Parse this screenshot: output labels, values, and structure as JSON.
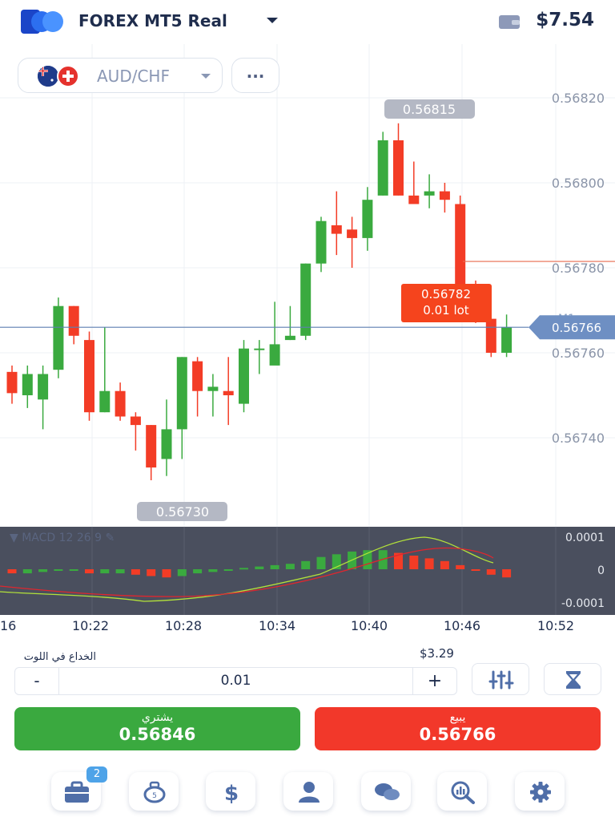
{
  "header": {
    "account_title": "FOREX MT5 Real",
    "balance": "$7.54"
  },
  "instrument": {
    "pair": "AUD/CHF",
    "more_label": "..."
  },
  "chart": {
    "price_labels": [
      "0.56820",
      "0.56800",
      "0.56780",
      "0.56760",
      "0.56740"
    ],
    "time_labels": [
      "16",
      "10:22",
      "10:28",
      "10:34",
      "10:40",
      "10:46",
      "10:52"
    ],
    "high_marker": "0.56815",
    "low_marker": "0.56730",
    "current_price": "0.56766",
    "timeframe": "M1",
    "order_price": "0.56782",
    "order_lot": "0.01 lot",
    "macd_label": "MACD 12 26 9",
    "macd_levels": [
      "0.0001",
      "0",
      "-0.0001"
    ],
    "colors": {
      "bull": "#3aaa3f",
      "bear": "#f33c26",
      "macd_bg": "#4a4f5e",
      "price_line": "#5577aa"
    }
  },
  "chart_data": {
    "type": "candlestick",
    "y_range": [
      0.56725,
      0.56835
    ],
    "candles": [
      {
        "o": 0.567555,
        "c": 0.567505,
        "h": 0.56757,
        "l": 0.56748
      },
      {
        "o": 0.5675,
        "c": 0.56755,
        "h": 0.56757,
        "l": 0.56747
      },
      {
        "o": 0.56749,
        "c": 0.56755,
        "h": 0.56757,
        "l": 0.56742
      },
      {
        "o": 0.56756,
        "c": 0.56771,
        "h": 0.56773,
        "l": 0.56754
      },
      {
        "o": 0.56771,
        "c": 0.56764,
        "h": 0.56771,
        "l": 0.56762
      },
      {
        "o": 0.56763,
        "c": 0.56746,
        "h": 0.56765,
        "l": 0.56744
      },
      {
        "o": 0.56746,
        "c": 0.56751,
        "h": 0.56766,
        "l": 0.56746
      },
      {
        "o": 0.56751,
        "c": 0.56745,
        "h": 0.56753,
        "l": 0.56744
      },
      {
        "o": 0.56745,
        "c": 0.56743,
        "h": 0.56746,
        "l": 0.56737
      },
      {
        "o": 0.56743,
        "c": 0.56733,
        "h": 0.56743,
        "l": 0.5673
      },
      {
        "o": 0.56735,
        "c": 0.56742,
        "h": 0.56749,
        "l": 0.56731
      },
      {
        "o": 0.56742,
        "c": 0.56759,
        "h": 0.56759,
        "l": 0.56735
      },
      {
        "o": 0.56758,
        "c": 0.56751,
        "h": 0.56759,
        "l": 0.56745
      },
      {
        "o": 0.56751,
        "c": 0.56752,
        "h": 0.56755,
        "l": 0.56745
      },
      {
        "o": 0.56751,
        "c": 0.5675,
        "h": 0.56759,
        "l": 0.56743
      },
      {
        "o": 0.56748,
        "c": 0.56761,
        "h": 0.56763,
        "l": 0.56746
      },
      {
        "o": 0.56761,
        "c": 0.56761,
        "h": 0.56763,
        "l": 0.56755
      },
      {
        "o": 0.56757,
        "c": 0.56762,
        "h": 0.56772,
        "l": 0.5676
      },
      {
        "o": 0.56763,
        "c": 0.56764,
        "h": 0.56771,
        "l": 0.56763
      },
      {
        "o": 0.56764,
        "c": 0.56781,
        "h": 0.56781,
        "l": 0.56763
      },
      {
        "o": 0.56781,
        "c": 0.56791,
        "h": 0.56792,
        "l": 0.56779
      },
      {
        "o": 0.5679,
        "c": 0.56788,
        "h": 0.56798,
        "l": 0.56783
      },
      {
        "o": 0.56789,
        "c": 0.56787,
        "h": 0.56792,
        "l": 0.5678
      },
      {
        "o": 0.56787,
        "c": 0.56796,
        "h": 0.56799,
        "l": 0.56784
      },
      {
        "o": 0.56797,
        "c": 0.5681,
        "h": 0.56812,
        "l": 0.56797
      },
      {
        "o": 0.5681,
        "c": 0.56797,
        "h": 0.56814,
        "l": 0.56797
      },
      {
        "o": 0.56797,
        "c": 0.56795,
        "h": 0.56805,
        "l": 0.56795
      },
      {
        "o": 0.56797,
        "c": 0.56798,
        "h": 0.56802,
        "l": 0.56794
      },
      {
        "o": 0.56798,
        "c": 0.56796,
        "h": 0.568,
        "l": 0.56793
      },
      {
        "o": 0.56795,
        "c": 0.56773,
        "h": 0.56797,
        "l": 0.56771
      },
      {
        "o": 0.56773,
        "c": 0.56768,
        "h": 0.56777,
        "l": 0.56767
      },
      {
        "o": 0.56768,
        "c": 0.5676,
        "h": 0.56768,
        "l": 0.56759
      },
      {
        "o": 0.5676,
        "c": 0.56766,
        "h": 0.56769,
        "l": 0.56759
      }
    ]
  },
  "trade": {
    "lot_label": "الخداع في اللوت",
    "margin": "$3.29",
    "lot_value": "0.01",
    "minus": "-",
    "plus": "+",
    "buy_label": "يشتري",
    "buy_price": "0.56846",
    "sell_label": "يبيع",
    "sell_price": "0.56766"
  },
  "nav": {
    "badge": "2"
  }
}
